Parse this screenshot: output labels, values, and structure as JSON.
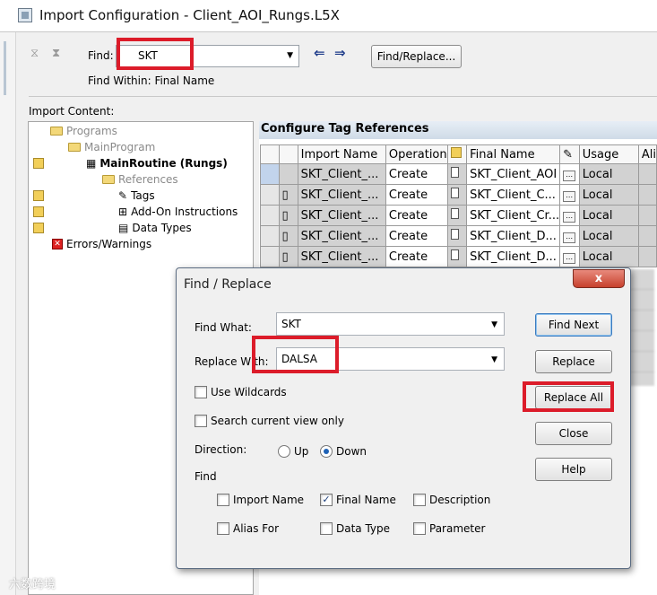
{
  "window": {
    "title": "Import Configuration - Client_AOI_Rungs.L5X"
  },
  "toolbar": {
    "find_label": "Find:",
    "find_value": "SKT",
    "find_within": "Find Within: Final Name",
    "find_replace_button": "Find/Replace..."
  },
  "import_content_label": "Import Content:",
  "tree": {
    "programs": "Programs",
    "main_program": "MainProgram",
    "main_routine": "MainRoutine (Rungs)",
    "references": "References",
    "tags": "Tags",
    "aoi": "Add-On Instructions",
    "data_types": "Data Types",
    "errors": "Errors/Warnings"
  },
  "grid": {
    "title": "Configure Tag References",
    "columns": [
      "Import Name",
      "Operation",
      "Final Name",
      "Usage",
      "Ali"
    ],
    "rows": [
      {
        "import_name": "SKT_Client_...",
        "operation": "Create",
        "final_name": "SKT_Client_AOI",
        "usage": "Local"
      },
      {
        "import_name": "SKT_Client_...",
        "operation": "Create",
        "final_name": "SKT_Client_C...",
        "usage": "Local"
      },
      {
        "import_name": "SKT_Client_...",
        "operation": "Create",
        "final_name": "SKT_Client_Cr...",
        "usage": "Local"
      },
      {
        "import_name": "SKT_Client_...",
        "operation": "Create",
        "final_name": "SKT_Client_D...",
        "usage": "Local"
      },
      {
        "import_name": "SKT_Client_...",
        "operation": "Create",
        "final_name": "SKT_Client_D...",
        "usage": "Local"
      }
    ]
  },
  "dialog": {
    "title": "Find / Replace",
    "find_what_label": "Find What:",
    "find_what_value": "SKT",
    "replace_with_label": "Replace With:",
    "replace_with_value": "DALSA",
    "use_wildcards": "Use Wildcards",
    "search_current_view": "Search current view only",
    "direction_label": "Direction:",
    "dir_up": "Up",
    "dir_down": "Down",
    "find_label": "Find",
    "opt_import_name": "Import Name",
    "opt_final_name": "Final Name",
    "opt_description": "Description",
    "opt_alias_for": "Alias For",
    "opt_data_type": "Data Type",
    "opt_parameter": "Parameter",
    "btn_find_next": "Find Next",
    "btn_replace": "Replace",
    "btn_replace_all": "Replace All",
    "btn_close": "Close",
    "btn_help": "Help",
    "close_glyph": "x"
  },
  "watermark": "六数跨境",
  "colors": {
    "highlight": "#dc1c2a",
    "grid_selected": "#c2d4ec"
  }
}
